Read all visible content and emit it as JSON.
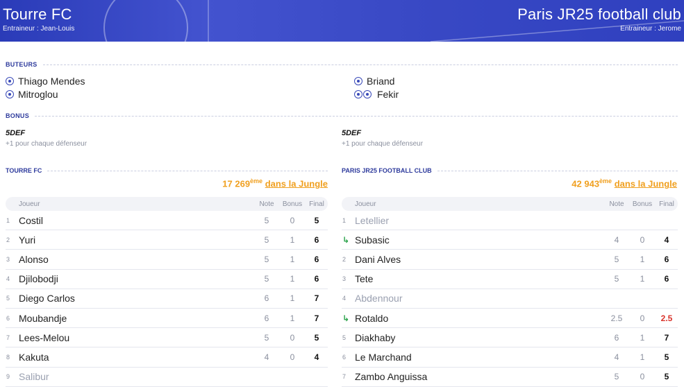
{
  "banner": {
    "home": {
      "name": "Tourre FC",
      "coach": "Entraineur : Jean-Louis"
    },
    "away": {
      "name": "Paris JR25 football club",
      "coach": "Entraineur : Jerome"
    }
  },
  "buteurs": {
    "label": "BUTEURS",
    "home": [
      {
        "name": "Thiago Mendes",
        "goals": 1
      },
      {
        "name": "Mitroglou",
        "goals": 1
      }
    ],
    "away": [
      {
        "name": "Briand",
        "goals": 1
      },
      {
        "name": "Fekir",
        "goals": 2
      }
    ]
  },
  "bonus": {
    "label": "BONUS",
    "home": {
      "title": "5DEF",
      "desc": "+1 pour chaque défenseur"
    },
    "away": {
      "title": "5DEF",
      "desc": "+1 pour chaque défenseur"
    }
  },
  "headers": {
    "player": "Joueur",
    "note": "Note",
    "bonus": "Bonus",
    "final": "Final"
  },
  "home_team": {
    "label": "TOURRE FC",
    "rank_num": "17 269",
    "rank_sup": "ème",
    "rank_link": "dans la Jungle",
    "players": [
      {
        "num": "1",
        "name": "Costil",
        "note": "5",
        "bonus": "0",
        "final": "5"
      },
      {
        "num": "2",
        "name": "Yuri",
        "note": "5",
        "bonus": "1",
        "final": "6"
      },
      {
        "num": "3",
        "name": "Alonso",
        "note": "5",
        "bonus": "1",
        "final": "6"
      },
      {
        "num": "4",
        "name": "Djilobodji",
        "note": "5",
        "bonus": "1",
        "final": "6"
      },
      {
        "num": "5",
        "name": "Diego Carlos",
        "note": "6",
        "bonus": "1",
        "final": "7"
      },
      {
        "num": "6",
        "name": "Moubandje",
        "note": "6",
        "bonus": "1",
        "final": "7"
      },
      {
        "num": "7",
        "name": "Lees-Melou",
        "note": "5",
        "bonus": "0",
        "final": "5"
      },
      {
        "num": "8",
        "name": "Kakuta",
        "note": "4",
        "bonus": "0",
        "final": "4"
      },
      {
        "num": "9",
        "name": "Salibur",
        "note": "",
        "bonus": "",
        "final": "",
        "inactive": true
      }
    ]
  },
  "away_team": {
    "label": "PARIS JR25 FOOTBALL CLUB",
    "rank_num": "42 943",
    "rank_sup": "ème",
    "rank_link": "dans la Jungle",
    "players": [
      {
        "num": "1",
        "name": "Letellier",
        "note": "",
        "bonus": "",
        "final": "",
        "inactive": true
      },
      {
        "num": "",
        "sub": true,
        "name": "Subasic",
        "note": "4",
        "bonus": "0",
        "final": "4"
      },
      {
        "num": "2",
        "name": "Dani Alves",
        "note": "5",
        "bonus": "1",
        "final": "6"
      },
      {
        "num": "3",
        "name": "Tete",
        "note": "5",
        "bonus": "1",
        "final": "6"
      },
      {
        "num": "4",
        "name": "Abdennour",
        "note": "",
        "bonus": "",
        "final": "",
        "inactive": true
      },
      {
        "num": "",
        "sub": true,
        "name": "Rotaldo",
        "note": "2.5",
        "bonus": "0",
        "final": "2.5",
        "red": true
      },
      {
        "num": "5",
        "name": "Diakhaby",
        "note": "6",
        "bonus": "1",
        "final": "7"
      },
      {
        "num": "6",
        "name": "Le Marchand",
        "note": "4",
        "bonus": "1",
        "final": "5"
      },
      {
        "num": "7",
        "name": "Zambo Anguissa",
        "note": "5",
        "bonus": "0",
        "final": "5"
      }
    ]
  },
  "colors": {
    "banner": "#3949c5",
    "accent": "#2d3a9c",
    "rank": "#f0a020",
    "sub_icon": "#2aa24a",
    "low_score": "#d9332b"
  }
}
